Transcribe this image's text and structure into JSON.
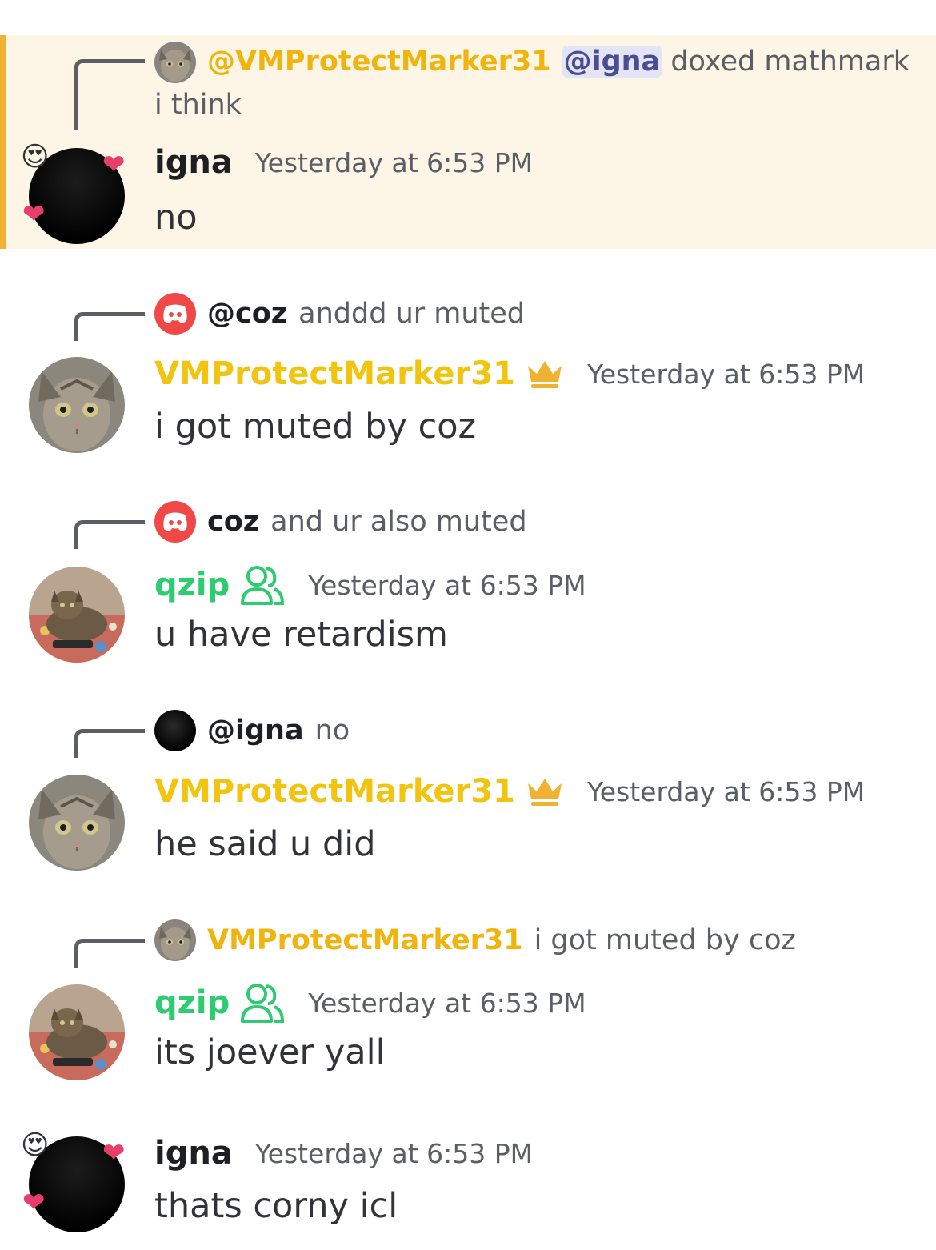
{
  "colors": {
    "highlight_bg": "#fdf6e7",
    "highlight_bar": "#f0b232",
    "owner_gold": "#f1c40f",
    "member_green": "#2ecc71",
    "discord_red": "#f04747",
    "mention_bg": "#e3e5f7"
  },
  "messages": [
    {
      "highlighted": true,
      "reply": {
        "avatar_icon": "cat-avatar-icon",
        "name": "@VMProtectMarker31",
        "mention": "@igna",
        "text": "doxed mathmark i think"
      },
      "author": "igna",
      "avatar_icon": "black-avatar-with-hearts-icon",
      "timestamp": "Yesterday at 6:53 PM",
      "content": "no"
    },
    {
      "reply": {
        "avatar_icon": "discord-logo-icon",
        "name": "@coz",
        "text": "anddd ur muted"
      },
      "author": "VMProtectMarker31",
      "badge_icon": "crown-icon",
      "avatar_icon": "cat-avatar-icon",
      "timestamp": "Yesterday at 6:53 PM",
      "content": "i got muted by coz"
    },
    {
      "reply": {
        "avatar_icon": "discord-logo-icon",
        "name": "coz",
        "text": "and ur also muted"
      },
      "author": "qzip",
      "badge_icon": "members-icon",
      "avatar_icon": "cat-lying-avatar-icon",
      "timestamp": "Yesterday at 6:53 PM",
      "content": "u have retardism"
    },
    {
      "reply": {
        "avatar_icon": "black-avatar-icon",
        "name": "@igna",
        "text": "no"
      },
      "author": "VMProtectMarker31",
      "badge_icon": "crown-icon",
      "avatar_icon": "cat-avatar-icon",
      "timestamp": "Yesterday at 6:53 PM",
      "content": "he said u did"
    },
    {
      "reply": {
        "avatar_icon": "cat-avatar-icon",
        "name": "VMProtectMarker31",
        "text": "i got muted by coz"
      },
      "author": "qzip",
      "badge_icon": "members-icon",
      "avatar_icon": "cat-lying-avatar-icon",
      "timestamp": "Yesterday at 6:53 PM",
      "content": "its joever yall"
    },
    {
      "author": "igna",
      "avatar_icon": "black-avatar-with-hearts-icon",
      "timestamp": "Yesterday at 6:53 PM",
      "content": "thats corny icl"
    }
  ]
}
